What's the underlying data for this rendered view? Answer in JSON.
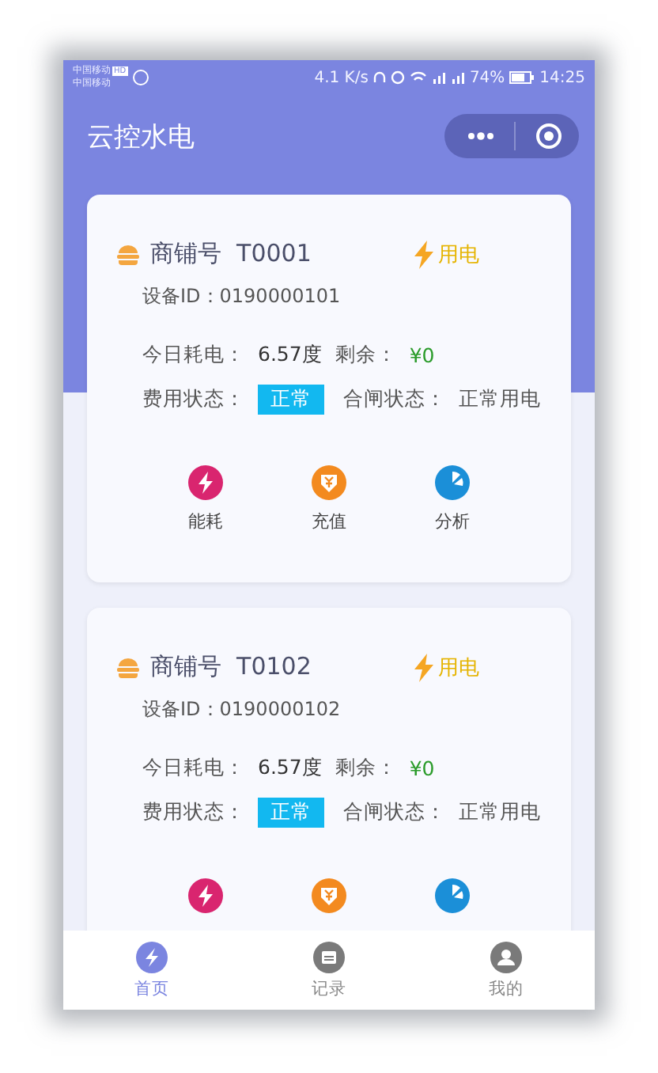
{
  "status_bar": {
    "carriers": [
      "中国移动",
      "中国移动"
    ],
    "hd": "HD",
    "speed": "4.1 K/s",
    "battery": "74%",
    "time": "14:25"
  },
  "nav": {
    "title": "云控水电"
  },
  "shops": [
    {
      "label": "商铺号",
      "code": "T0001",
      "mode": "用电",
      "device": "设备ID：0190000101",
      "usage_label": "今日耗电：",
      "usage": "6.57度",
      "balance_label": "剩余：",
      "balance": "¥0",
      "fee_label": "费用状态：",
      "fee_status": "正常",
      "switch_label": "合闸状态：",
      "switch_status": "正常用电",
      "actions": [
        {
          "kind": "energy",
          "label": "能耗"
        },
        {
          "kind": "recharge",
          "label": "充值"
        },
        {
          "kind": "analysis",
          "label": "分析"
        }
      ]
    },
    {
      "label": "商铺号",
      "code": "T0102",
      "mode": "用电",
      "device": "设备ID：0190000102",
      "usage_label": "今日耗电：",
      "usage": "6.57度",
      "balance_label": "剩余：",
      "balance": "¥0",
      "fee_label": "费用状态：",
      "fee_status": "正常",
      "switch_label": "合闸状态：",
      "switch_status": "正常用电",
      "actions": [
        {
          "kind": "energy"
        },
        {
          "kind": "recharge"
        },
        {
          "kind": "analysis"
        }
      ]
    }
  ],
  "tabs": [
    {
      "kind": "home",
      "label": "首页",
      "selected": true
    },
    {
      "kind": "records",
      "label": "记录",
      "selected": false
    },
    {
      "kind": "profile",
      "label": "我的",
      "selected": false
    }
  ]
}
